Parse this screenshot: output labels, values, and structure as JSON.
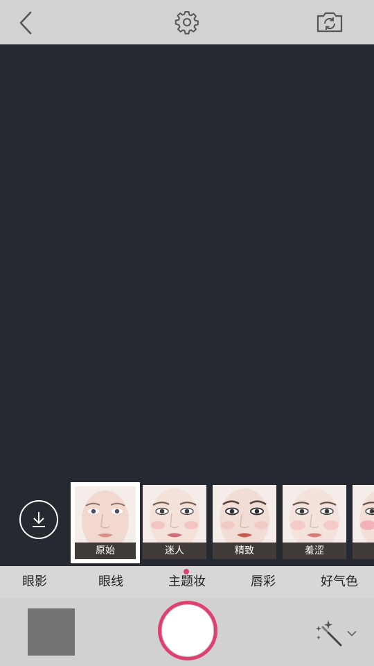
{
  "topbar": {
    "back_icon": "chevron-left-icon",
    "settings_icon": "gear-icon",
    "switch_camera_icon": "camera-switch-icon"
  },
  "download_icon": "download-icon",
  "looks": [
    {
      "label": "原始",
      "selected": true,
      "lip_color": "#d98f8a",
      "blush": "none"
    },
    {
      "label": "迷人",
      "selected": false,
      "lip_color": "#cf6e78",
      "blush": "#f2b9b6"
    },
    {
      "label": "精致",
      "selected": false,
      "lip_color": "#c75a52",
      "blush": "#f1c2bb"
    },
    {
      "label": "羞涩",
      "selected": false,
      "lip_color": "#d77e7b",
      "blush": "#f3c6c3"
    },
    {
      "label": "",
      "selected": false,
      "lip_color": "#cf5f70",
      "blush": "#f0a7b1"
    }
  ],
  "tabs": [
    {
      "label": "眼影",
      "active": false
    },
    {
      "label": "眼线",
      "active": false
    },
    {
      "label": "主题妆",
      "active": true
    },
    {
      "label": "唇彩",
      "active": false
    },
    {
      "label": "好气色",
      "active": false
    }
  ],
  "bottom": {
    "gallery_icon": "gallery-thumbnail",
    "shutter_icon": "shutter-button",
    "magic_icon": "magic-wand-icon",
    "expand_icon": "chevron-down-icon"
  },
  "colors": {
    "accent": "#e0406f",
    "bar": "#d2d2d2",
    "preview": "#26292f"
  }
}
